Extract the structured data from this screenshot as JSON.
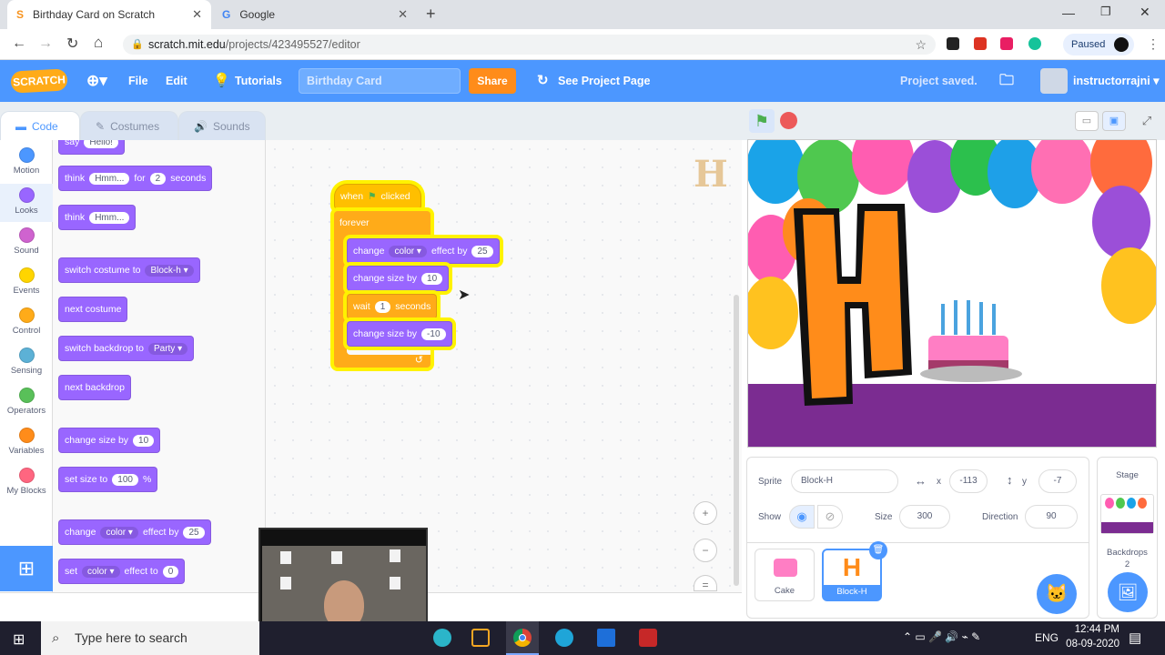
{
  "browser": {
    "tabs": [
      {
        "title": "Birthday Card on Scratch"
      },
      {
        "title": "Google"
      }
    ],
    "url_host": "scratch.mit.edu",
    "url_path": "/projects/423495527/editor",
    "profile_status": "Paused"
  },
  "menu": {
    "file": "File",
    "edit": "Edit",
    "tutorials": "Tutorials",
    "project_title": "Birthday Card",
    "share": "Share",
    "see_project": "See Project Page",
    "saved": "Project saved.",
    "username": "instructorrajni"
  },
  "editor_tabs": {
    "code": "Code",
    "costumes": "Costumes",
    "sounds": "Sounds"
  },
  "categories": [
    {
      "label": "Motion",
      "color": "#4c97ff"
    },
    {
      "label": "Looks",
      "color": "#9966ff"
    },
    {
      "label": "Sound",
      "color": "#cf63cf"
    },
    {
      "label": "Events",
      "color": "#ffd500"
    },
    {
      "label": "Control",
      "color": "#ffab19"
    },
    {
      "label": "Sensing",
      "color": "#5cb1d6"
    },
    {
      "label": "Operators",
      "color": "#59c059"
    },
    {
      "label": "Variables",
      "color": "#ff8c1a"
    },
    {
      "label": "My Blocks",
      "color": "#ff6680"
    }
  ],
  "palette": {
    "say_hello": {
      "say": "say",
      "msg": "Hello!"
    },
    "think_for": {
      "think": "think",
      "msg": "Hmm...",
      "for": "for",
      "secs": "2",
      "seconds": "seconds"
    },
    "think": {
      "think": "think",
      "msg": "Hmm..."
    },
    "switch_costume": {
      "label": "switch costume to",
      "value": "Block-h"
    },
    "next_costume": "next costume",
    "switch_backdrop": {
      "label": "switch backdrop to",
      "value": "Party"
    },
    "next_backdrop": "next backdrop",
    "change_size": {
      "label": "change size by",
      "value": "10"
    },
    "set_size": {
      "label": "set size to",
      "value": "100",
      "pct": "%"
    },
    "change_effect": {
      "change": "change",
      "effect": "color",
      "by": "effect by",
      "value": "25"
    },
    "set_effect": {
      "set": "set",
      "effect": "color",
      "to": "effect to",
      "value": "0"
    }
  },
  "script": {
    "when_clicked": {
      "when": "when",
      "clicked": "clicked"
    },
    "forever": "forever",
    "change_effect": {
      "change": "change",
      "effect": "color",
      "by": "effect by",
      "value": "25"
    },
    "change_size_1": {
      "label": "change size by",
      "value": "10"
    },
    "wait": {
      "wait": "wait",
      "value": "1",
      "seconds": "seconds"
    },
    "change_size_2": {
      "label": "change size by",
      "value": "-10"
    }
  },
  "sprite_info": {
    "sprite_label": "Sprite",
    "sprite_name": "Block-H",
    "x_label": "x",
    "x": "-113",
    "y_label": "y",
    "y": "-7",
    "show_label": "Show",
    "size_label": "Size",
    "size": "300",
    "direction_label": "Direction",
    "direction": "90"
  },
  "sprites": [
    {
      "name": "Cake"
    },
    {
      "name": "Block-H"
    }
  ],
  "stage_panel": {
    "title": "Stage",
    "backdrops_label": "Backdrops",
    "backdrops_count": "2"
  },
  "taskbar": {
    "search_placeholder": "Type here to search",
    "lang": "ENG",
    "time": "12:44 PM",
    "date": "08-09-2020"
  },
  "stage_letter": "H"
}
